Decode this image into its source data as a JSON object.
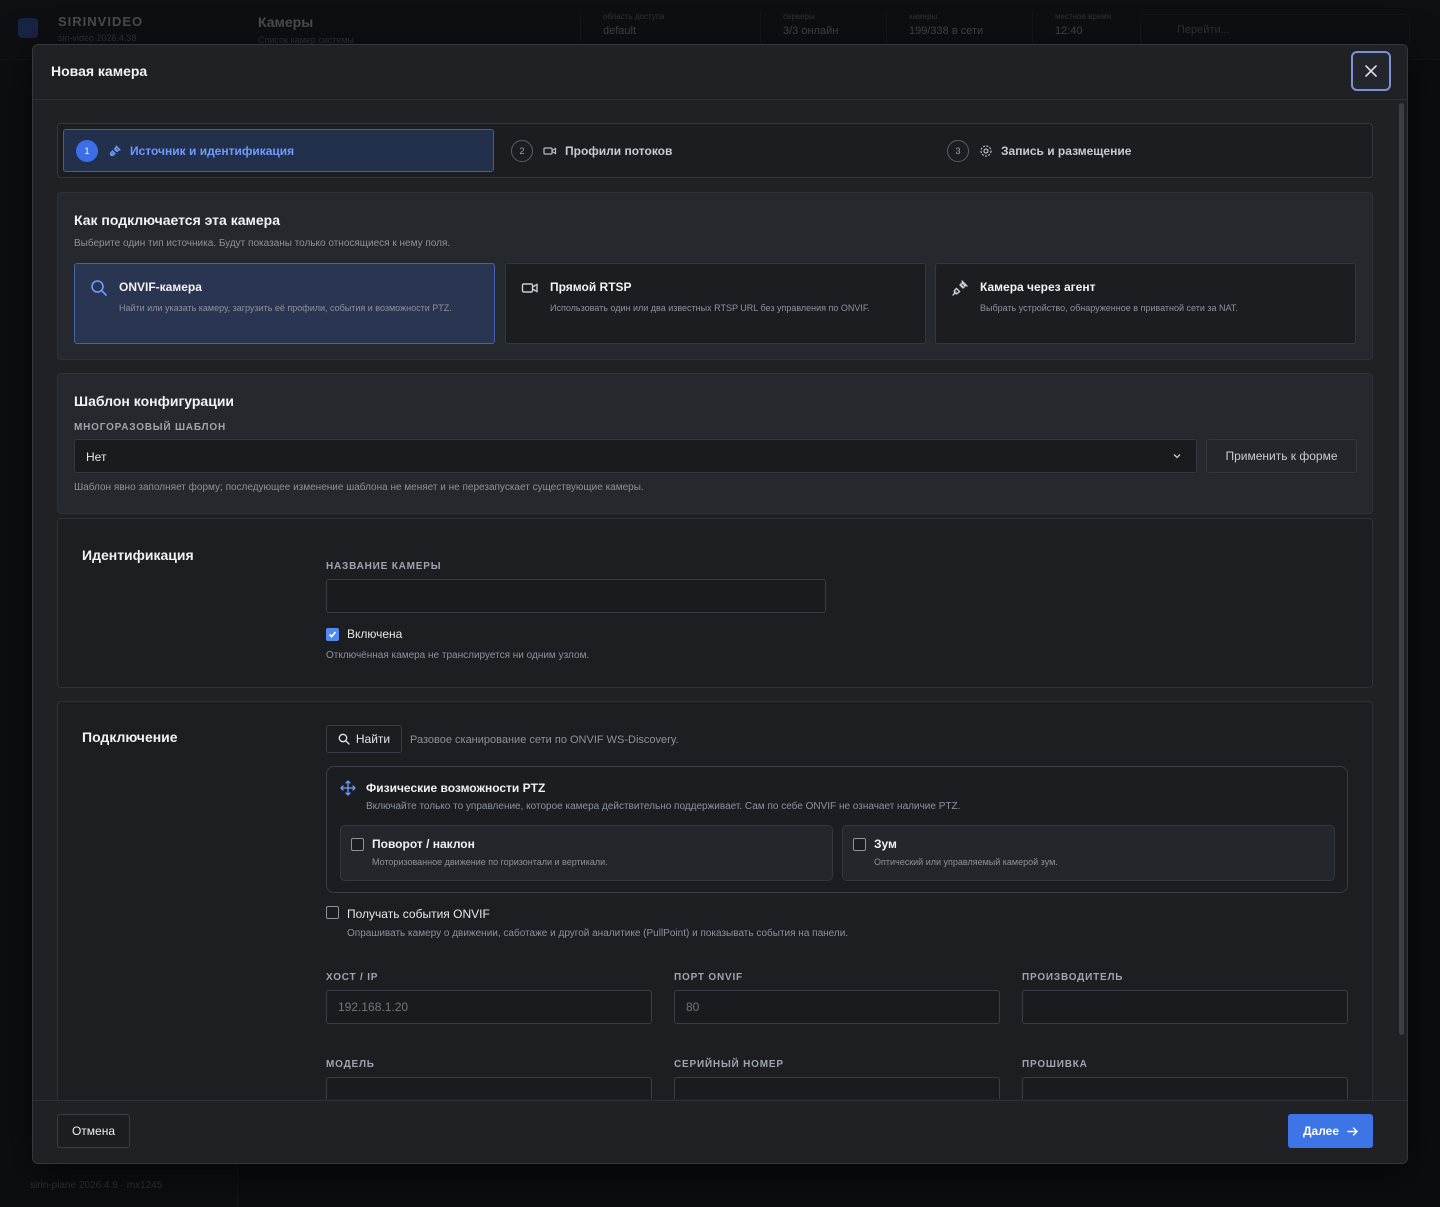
{
  "background": {
    "brand": "SIRINVIDEO",
    "brand_sub": "siri-video 2026.4.38",
    "page_title": "Камеры",
    "page_sub": "Список камер системы",
    "stats": [
      {
        "key": "область доступа",
        "value": "default"
      },
      {
        "key": "серверы",
        "value": "3/3 онлайн"
      },
      {
        "key": "камеры",
        "value": "199/338 в сети"
      },
      {
        "key": "местное время",
        "value": "12:40"
      }
    ],
    "search_placeholder": "Перейти...",
    "footer": "sirin-plane 2026.4.8 · mx1245"
  },
  "modal": {
    "title": "Новая камера",
    "close_icon": "close-icon",
    "steps": [
      {
        "num": "1",
        "label": "Источник и идентификация",
        "icon": "plug-icon",
        "active": true
      },
      {
        "num": "2",
        "label": "Профили потоков",
        "icon": "video-icon",
        "active": false
      },
      {
        "num": "3",
        "label": "Запись и размещение",
        "icon": "gear-icon",
        "active": false
      }
    ],
    "source": {
      "title": "Как подключается эта камера",
      "hint": "Выберите один тип источника. Будут показаны только относящиеся к нему поля.",
      "options": [
        {
          "title": "ONVIF-камера",
          "desc": "Найти или указать камеру, загрузить её профили, события и возможности PTZ.",
          "icon": "search-icon",
          "selected": true
        },
        {
          "title": "Прямой RTSP",
          "desc": "Использовать один или два известных RTSP URL без управления по ONVIF.",
          "icon": "video-icon",
          "selected": false
        },
        {
          "title": "Камера через агент",
          "desc": "Выбрать устройство, обнаруженное в приватной сети за NAT.",
          "icon": "plug-icon",
          "selected": false
        }
      ]
    },
    "template": {
      "title": "Шаблон конфигурации",
      "label": "Многоразовый шаблон",
      "selected": "Нет",
      "apply_label": "Применить к форме",
      "hint": "Шаблон явно заполняет форму; последующее изменение шаблона не меняет и не перезапускает существующие камеры."
    },
    "identification": {
      "title": "Идентификация",
      "name_label": "Название камеры",
      "name_value": "",
      "enabled_label": "Включена",
      "enabled": true,
      "enabled_hint": "Отключённая камера не транслируется ни одним узлом."
    },
    "connection": {
      "title": "Подключение",
      "find_label": "Найти",
      "find_hint": "Разовое сканирование сети по ONVIF WS-Discovery.",
      "ptz": {
        "title": "Физические возможности PTZ",
        "hint": "Включайте только то управление, которое камера действительно поддерживает. Сам по себе ONVIF не означает наличие PTZ.",
        "options": [
          {
            "title": "Поворот / наклон",
            "desc": "Моторизованное движение по горизонтали и вертикали.",
            "checked": false
          },
          {
            "title": "Зум",
            "desc": "Оптический или управляемый камерой зум.",
            "checked": false
          }
        ]
      },
      "events_label": "Получать события ONVIF",
      "events_checked": false,
      "events_hint": "Опрашивать камеру о движении, саботаже и другой аналитике (PullPoint) и показывать события на панели.",
      "fields": [
        {
          "label": "Хост / IP",
          "value": "",
          "placeholder": "192.168.1.20"
        },
        {
          "label": "Порт ONVIF",
          "value": "",
          "placeholder": "80"
        },
        {
          "label": "Производитель",
          "value": "",
          "placeholder": ""
        },
        {
          "label": "Модель",
          "value": "",
          "placeholder": ""
        },
        {
          "label": "Серийный номер",
          "value": "",
          "placeholder": ""
        },
        {
          "label": "Прошивка",
          "value": "",
          "placeholder": ""
        }
      ]
    },
    "footer": {
      "cancel_label": "Отмена",
      "next_label": "Далее"
    }
  },
  "colors": {
    "accent": "#3d74e6",
    "accent_text": "#6e9bff",
    "modal_bg": "#1f2125"
  }
}
